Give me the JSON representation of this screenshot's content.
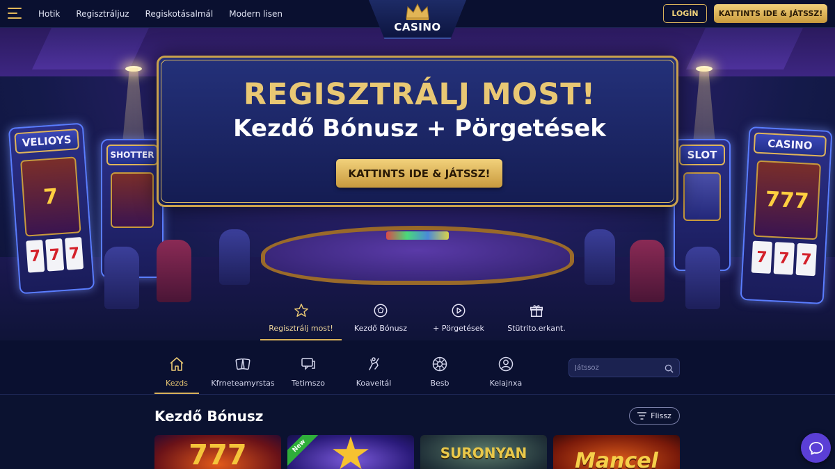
{
  "header": {
    "nav": [
      "Hotik",
      "Regisztráljuz",
      "Regiskotásalmál",
      "Modern lisen"
    ],
    "logo_text": "CASINO",
    "login_label": "LOGİN",
    "cta_label": "KATTINTS IDE & JÁTSSZ!"
  },
  "hero": {
    "title": "REGISZTRÁLJ MOST!",
    "subtitle": "Kezdő Bónusz + Pörgetések",
    "button_label": "KATTINTS IDE & JÁTSSZ!",
    "machine_signs": [
      "VELIOYS",
      "SHOTTER",
      "SLOT",
      "CASINO"
    ],
    "tabs": [
      {
        "label": "Regisztrálj most!",
        "icon": "star-icon",
        "active": true
      },
      {
        "label": "Kezdő Bónusz",
        "icon": "soccer-ball-icon",
        "active": false
      },
      {
        "label": "+ Pörgetések",
        "icon": "play-circle-icon",
        "active": false
      },
      {
        "label": "Stütrito.erkant.",
        "icon": "gift-icon",
        "active": false
      }
    ]
  },
  "categories": {
    "items": [
      {
        "label": "Kezds",
        "icon": "home-icon",
        "active": true
      },
      {
        "label": "Kfrneteamyrstas",
        "icon": "cards-icon",
        "active": false
      },
      {
        "label": "Tetimszo",
        "icon": "chat-icon",
        "active": false
      },
      {
        "label": "Koaveitál",
        "icon": "hand-icon",
        "active": false
      },
      {
        "label": "Besb",
        "icon": "roulette-icon",
        "active": false
      },
      {
        "label": "Kelajnxa",
        "icon": "user-icon",
        "active": false
      }
    ],
    "search_placeholder": "Játssoz"
  },
  "games": {
    "section_title": "Kezdő Bónusz",
    "filter_label": "Flissz",
    "cards": [
      {
        "title": "777",
        "badge": ""
      },
      {
        "title": "",
        "badge": "New"
      },
      {
        "title": "SURONYAN",
        "badge": ""
      },
      {
        "title": "Mancel",
        "badge": ""
      }
    ]
  },
  "colors": {
    "accent_gold": "#e9c874",
    "background": "#0b1230",
    "chat": "#5b3fd6"
  }
}
